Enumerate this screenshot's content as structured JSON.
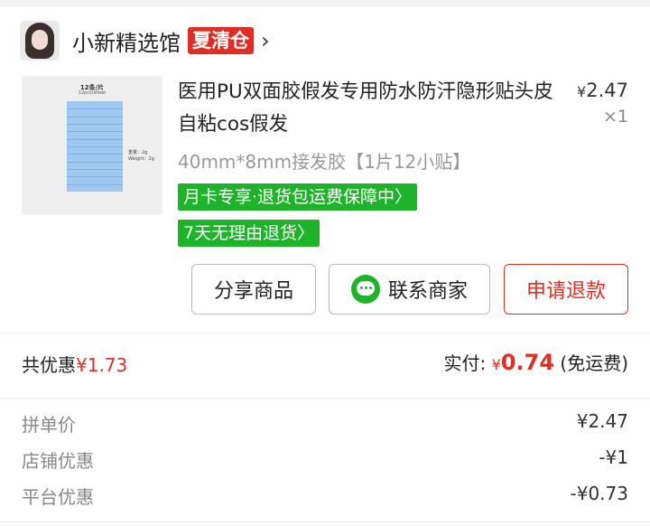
{
  "shop": {
    "name": "小新精选馆",
    "badge": "夏清仓",
    "chevron": "›",
    "avatar_icon": "shop-avatar"
  },
  "product": {
    "title": "医用PU双面胶假发专用防水防汗隐形贴头皮自粘cos假发",
    "price_symbol": "¥",
    "price": "2.47",
    "quantity": "×1",
    "spec": "40mm*8mm接发胶【1片12小贴】",
    "tags": [
      "月卡专享·退货包运费保障中〉",
      "7天无理由退货〉"
    ],
    "thumb": {
      "title": "12条/片",
      "subtitle": "12pcs/sheet",
      "weight": "重量：2g",
      "weight_en": "Weight：2g",
      "strips": 12
    }
  },
  "actions": {
    "share": "分享商品",
    "contact": "联系商家",
    "refund": "申请退款",
    "contact_icon": "chat-icon"
  },
  "totals": {
    "discount_label": "共优惠",
    "discount_value": "¥1.73",
    "paid_label": "实付:",
    "paid_symbol": "¥",
    "paid_value": "0.74",
    "shipping_note": "(免运费)"
  },
  "summary": [
    {
      "label": "拼单价",
      "value": "¥2.47"
    },
    {
      "label": "店铺优惠",
      "value": "-¥1"
    },
    {
      "label": "平台优惠",
      "value": "-¥0.73"
    }
  ],
  "colors": {
    "accent_red": "#e02e24",
    "green": "#1db42a"
  }
}
